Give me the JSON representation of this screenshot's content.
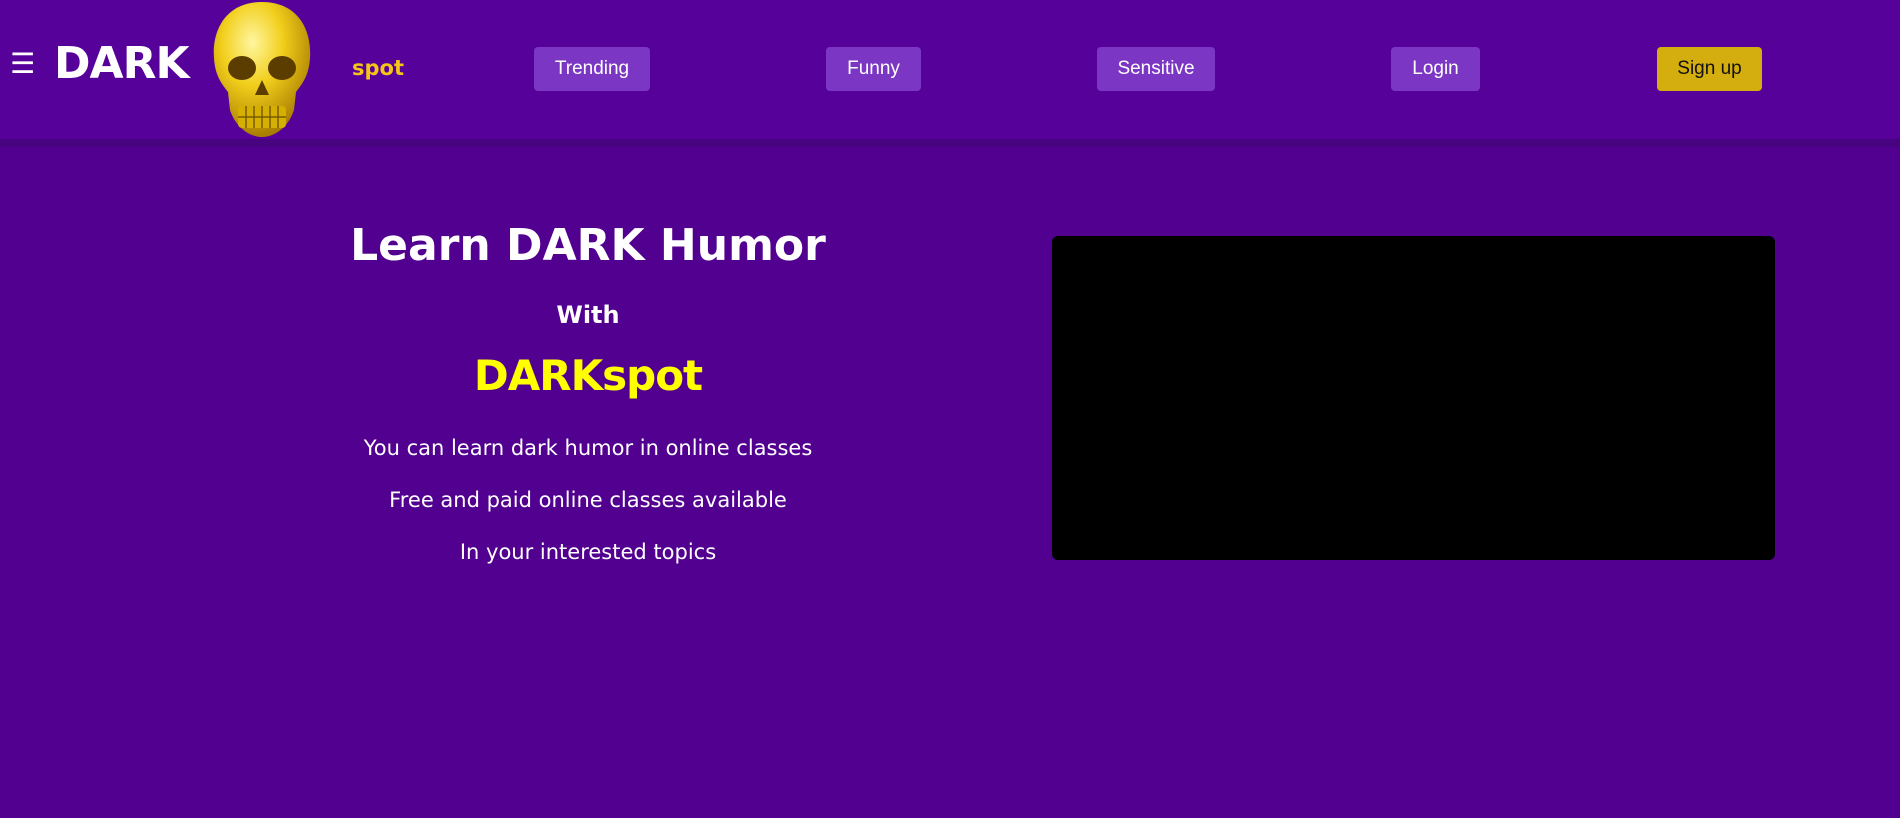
{
  "brand": {
    "dark": "DARK",
    "spot": "spot",
    "logo_icon": "skull-icon"
  },
  "nav": {
    "menu_icon": "hamburger-icon",
    "items": [
      {
        "label": "Trending"
      },
      {
        "label": "Funny"
      },
      {
        "label": "Sensitive"
      },
      {
        "label": "Login"
      }
    ],
    "signup": "Sign up"
  },
  "hero": {
    "title": "Learn DARK Humor",
    "with": "With",
    "brand": "DARKspot",
    "lines": [
      "You can learn dark humor in online classes",
      "Free and paid online classes available",
      "In your interested topics"
    ]
  },
  "colors": {
    "page_background": "#52008f",
    "nav_background": "#56029a",
    "nav_button": "#7b36c4",
    "signup_button": "#d4ad0f",
    "brand_yellow": "#ffff00",
    "spot_yellow": "#f5c518"
  }
}
